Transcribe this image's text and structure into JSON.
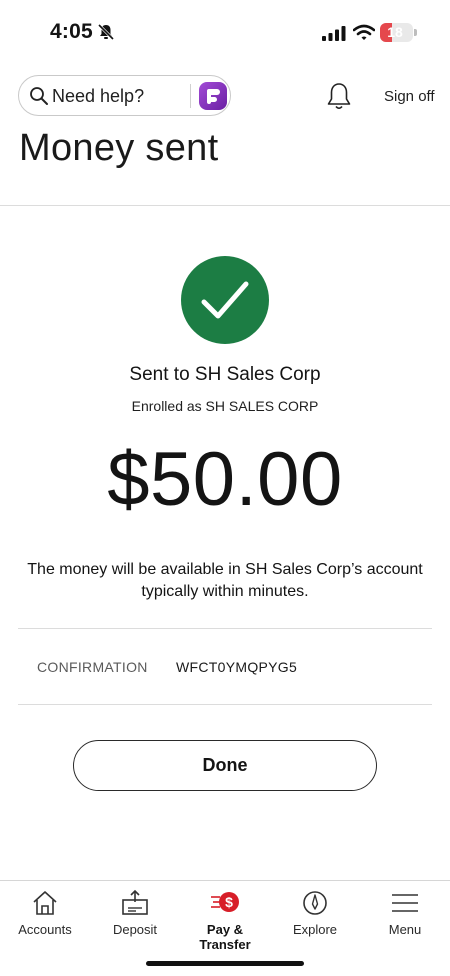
{
  "status": {
    "time": "4:05",
    "battery": "18",
    "battery_level": 0.18
  },
  "header": {
    "help_text": "Need help?",
    "sign_off": "Sign off"
  },
  "page": {
    "title": "Money sent"
  },
  "success": {
    "sent_to": "Sent to SH Sales Corp",
    "enrolled": "Enrolled as SH SALES CORP",
    "amount": "$50.00",
    "availability": "The money will be available in SH Sales Corp’s account typically within minutes."
  },
  "confirmation": {
    "label": "CONFIRMATION",
    "value": "WFCT0YMQPYG5"
  },
  "actions": {
    "done_label": "Done"
  },
  "tabs": [
    {
      "label": "Accounts",
      "icon": "home-icon",
      "active": false
    },
    {
      "label": "Deposit",
      "icon": "deposit-icon",
      "active": false
    },
    {
      "label": "Pay & Transfer",
      "icon": "pay-transfer-icon",
      "active": true
    },
    {
      "label": "Explore",
      "icon": "compass-icon",
      "active": false
    },
    {
      "label": "Menu",
      "icon": "menu-icon",
      "active": false
    }
  ],
  "colors": {
    "success_green": "#1c7d44",
    "brand_red": "#d71e28",
    "assistant_purple": "#8a35c4"
  }
}
